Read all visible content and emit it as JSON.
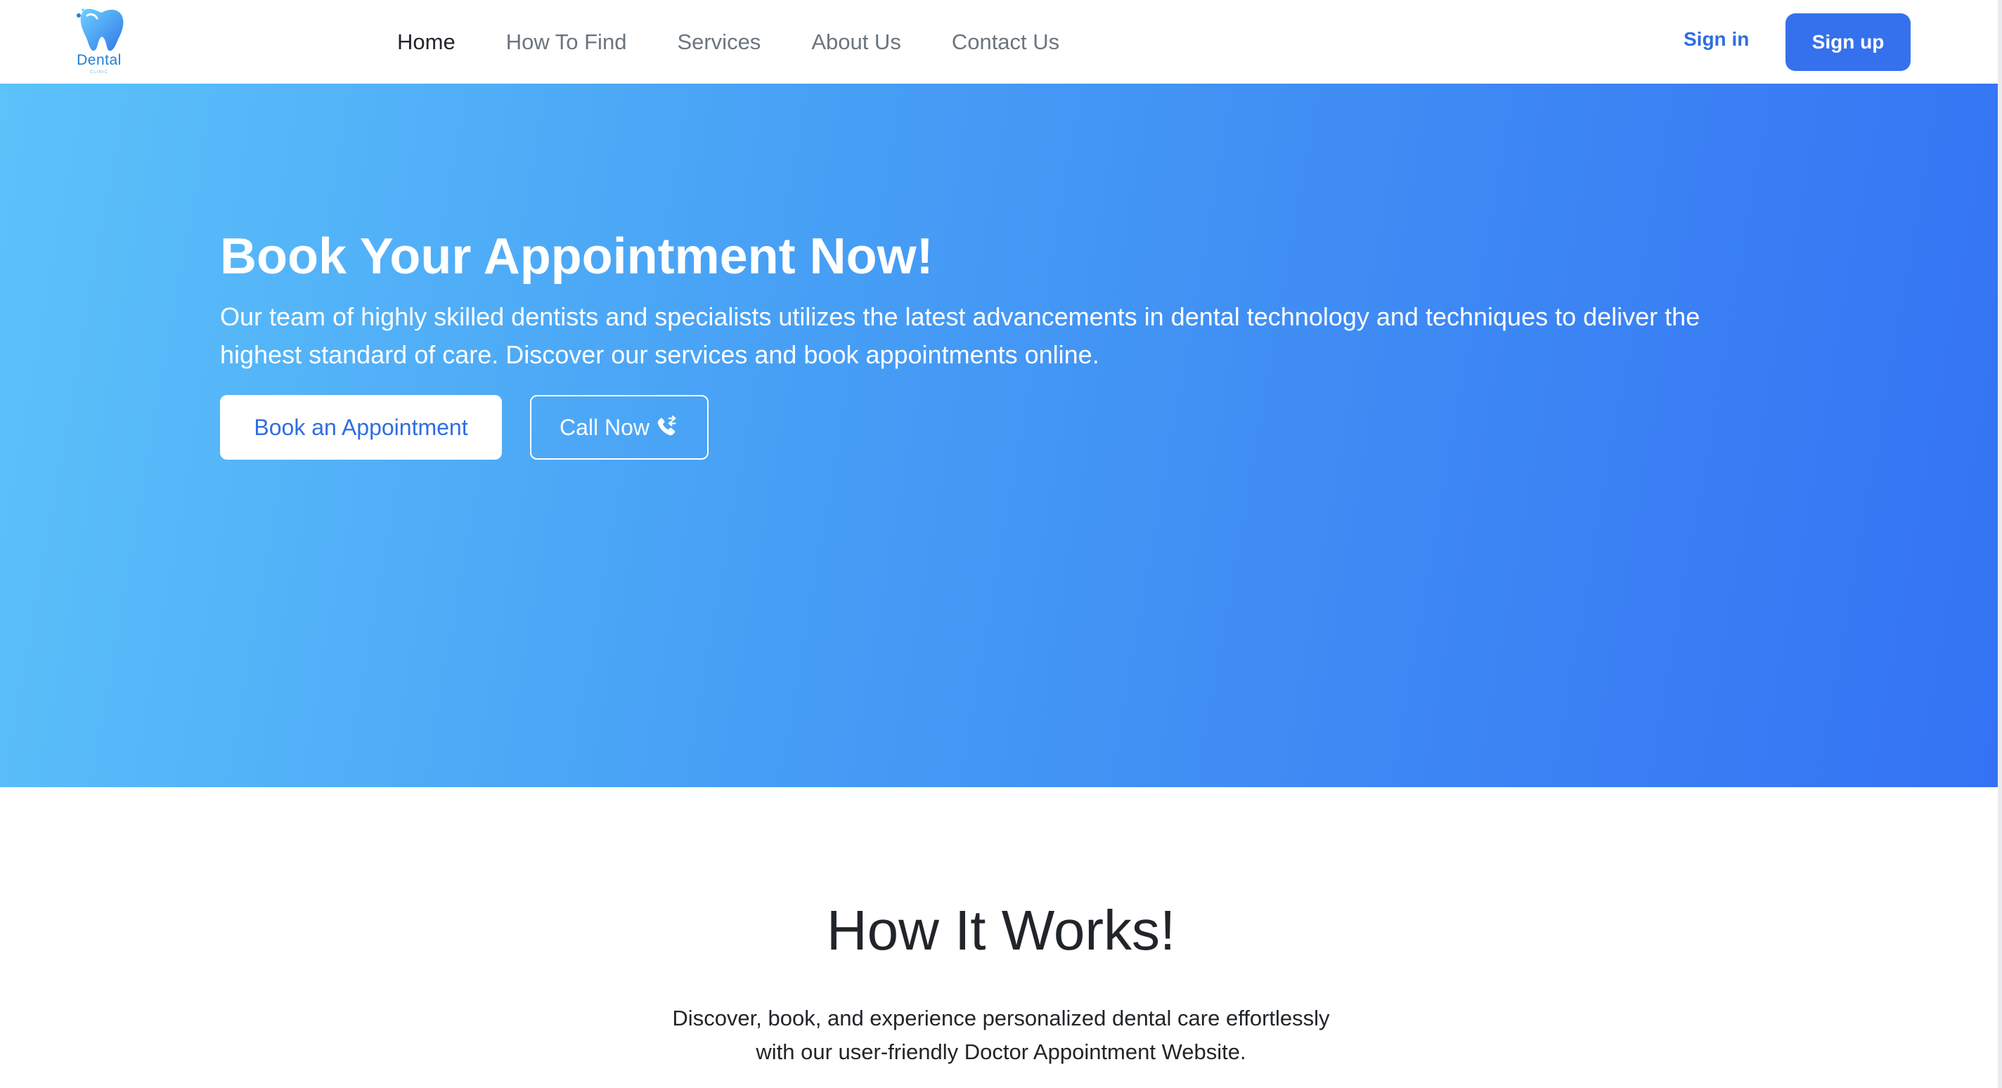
{
  "brand": {
    "logo_text": "Dental",
    "logo_subtext": "CLINIC",
    "primary_color": "#3571ec",
    "link_color": "#2f6ee0"
  },
  "nav": {
    "items": [
      {
        "label": "Home",
        "active": true
      },
      {
        "label": "How To Find",
        "active": false
      },
      {
        "label": "Services",
        "active": false
      },
      {
        "label": "About Us",
        "active": false
      },
      {
        "label": "Contact Us",
        "active": false
      }
    ],
    "sign_in": "Sign in",
    "sign_up": "Sign up"
  },
  "hero": {
    "title": "Book Your Appointment Now!",
    "description": "Our team of highly skilled dentists and specialists utilizes the latest advancements in dental technology and techniques to deliver the highest standard of care. Discover our services and book appointments online.",
    "book_button": "Book an Appointment",
    "call_button": "Call Now",
    "call_icon": "phone-icon",
    "gradient": [
      "#5cc2fa",
      "#3472f3"
    ]
  },
  "how_it_works": {
    "title": "How It Works!",
    "description_line1": "Discover, book, and experience personalized dental care effortlessly",
    "description_line2": "with our user-friendly Doctor Appointment Website."
  }
}
